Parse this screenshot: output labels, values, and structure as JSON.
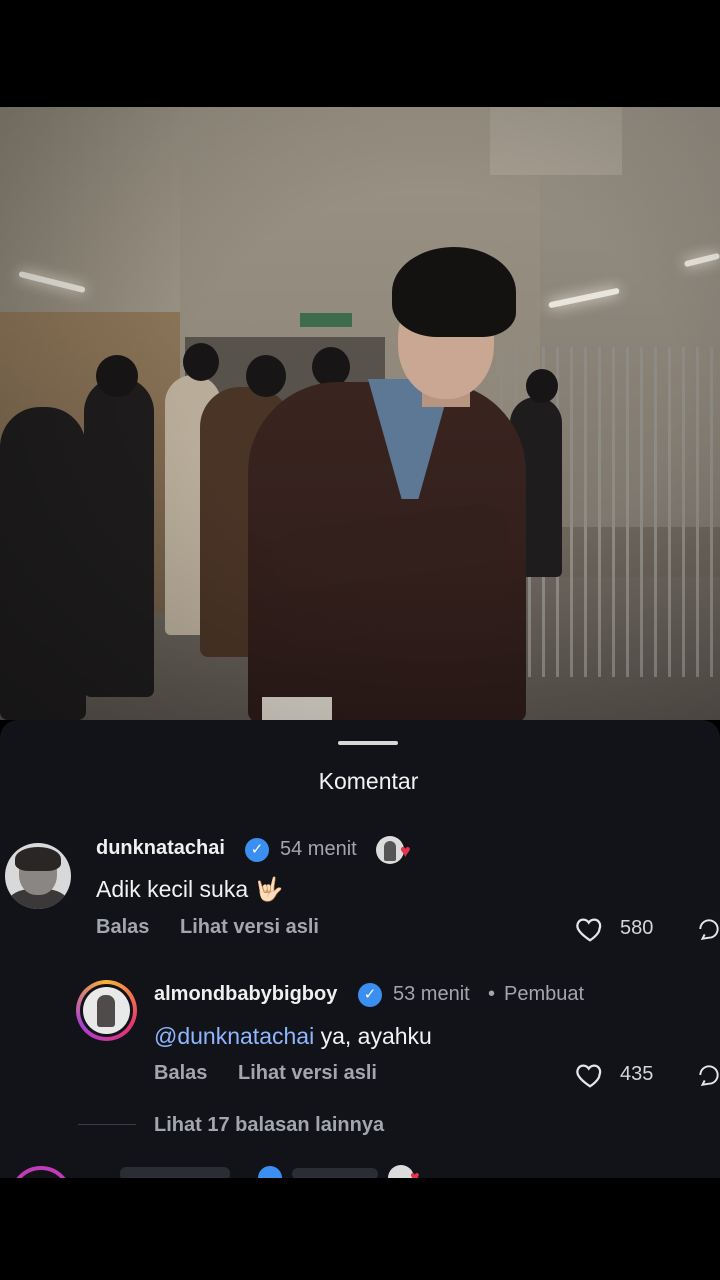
{
  "sheet": {
    "title": "Komentar"
  },
  "comments": [
    {
      "username": "dunknatachai",
      "time": "54 menit",
      "text": "Adik kecil suka",
      "emoji": "🤟🏻",
      "reply_label": "Balas",
      "translate_label": "Lihat versi asli",
      "likes": "580"
    },
    {
      "username": "almondbabybigboy",
      "time": "53 menit",
      "separator": "•",
      "author_label": "Pembuat",
      "mention": "@dunknatachai",
      "text": " ya, ayahku",
      "reply_label": "Balas",
      "translate_label": "Lihat versi asli",
      "likes": "435"
    }
  ],
  "more_replies": "Lihat 17 balasan lainnya",
  "icons": {
    "verified": "verified-badge-icon",
    "like": "heart-outline-icon",
    "reply": "share-reply-icon",
    "liked_by_author": "author-liked-heart-icon"
  },
  "colors": {
    "sheet_bg": "#111319",
    "verified_blue": "#3b8ff0",
    "mention": "#8fb6ff",
    "heart_red": "#e8334e"
  }
}
